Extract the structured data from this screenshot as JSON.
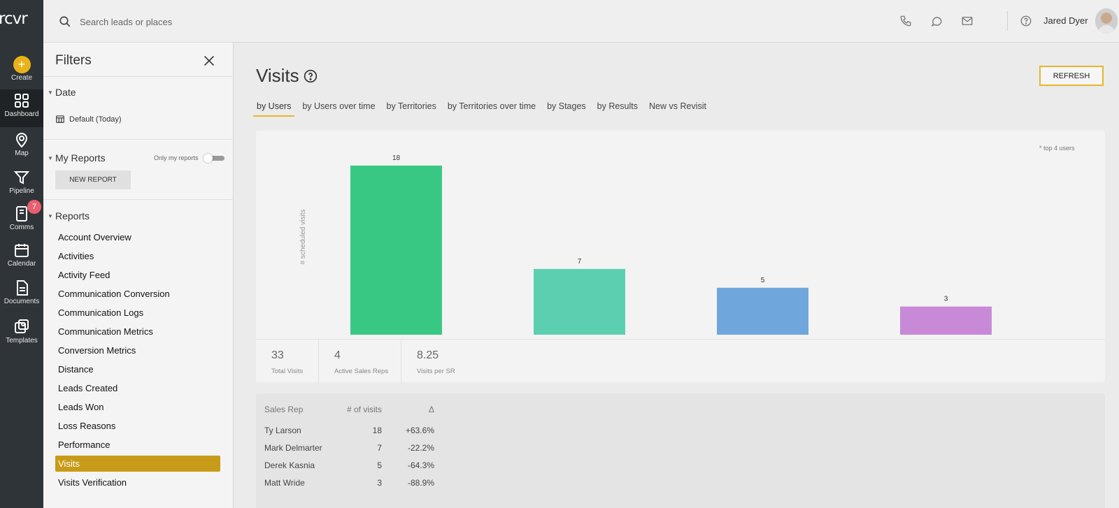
{
  "app": {
    "logo": "rcvr"
  },
  "rail": {
    "items": [
      {
        "label": "Create",
        "icon": "plus-icon"
      },
      {
        "label": "Dashboard",
        "icon": "dashboard-icon"
      },
      {
        "label": "Map",
        "icon": "map-pin-icon"
      },
      {
        "label": "Pipeline",
        "icon": "funnel-icon"
      },
      {
        "label": "Comms",
        "icon": "comms-icon",
        "badge": "7"
      },
      {
        "label": "Calendar",
        "icon": "calendar-icon"
      },
      {
        "label": "Documents",
        "icon": "document-icon"
      },
      {
        "label": "Templates",
        "icon": "templates-icon"
      }
    ]
  },
  "topbar": {
    "search_placeholder": "Search leads or places",
    "user_name": "Jared Dyer"
  },
  "filters": {
    "title": "Filters",
    "date_section": "Date",
    "date_value": "Default (Today)",
    "my_reports_section": "My Reports",
    "only_my_reports_label": "Only my reports",
    "new_report_label": "NEW REPORT",
    "reports_section": "Reports",
    "reports": [
      "Account Overview",
      "Activities",
      "Activity Feed",
      "Communication Conversion",
      "Communication Logs",
      "Communication Metrics",
      "Conversion Metrics",
      "Distance",
      "Leads Created",
      "Leads Won",
      "Loss Reasons",
      "Performance",
      "Visits",
      "Visits Verification"
    ],
    "active_report": "Visits"
  },
  "main": {
    "title": "Visits",
    "refresh_label": "REFRESH",
    "tabs": [
      "by Users",
      "by Users over time",
      "by Territories",
      "by Territories over time",
      "by Stages",
      "by Results",
      "New vs Revisit"
    ],
    "active_tab": "by Users",
    "top_note": "* top 4 users",
    "stats": [
      {
        "value": "33",
        "label": "Total Visits"
      },
      {
        "value": "4",
        "label": "Active Sales Reps"
      },
      {
        "value": "8.25",
        "label": "Visits per SR"
      }
    ],
    "table": {
      "headers": [
        "Sales Rep",
        "# of visits",
        "Δ"
      ],
      "rows": [
        {
          "rep": "Ty Larson",
          "visits": "18",
          "delta": "+63.6%",
          "trend": "up"
        },
        {
          "rep": "Mark Delmarter",
          "visits": "7",
          "delta": "-22.2%",
          "trend": "down"
        },
        {
          "rep": "Derek Kasnia",
          "visits": "5",
          "delta": "-64.3%",
          "trend": "down"
        },
        {
          "rep": "Matt Wride",
          "visits": "3",
          "delta": "-88.9%",
          "trend": "down"
        }
      ]
    }
  },
  "colors": {
    "accent": "#e6b62a",
    "active_report_bg": "#c79b18",
    "positive": "#6aa84f",
    "negative": "#b03a3a"
  },
  "chart_data": {
    "type": "bar",
    "categories": [
      "",
      "",
      "",
      ""
    ],
    "values": [
      18,
      7,
      5,
      3
    ],
    "colors": [
      "#38c883",
      "#5ccfb0",
      "#6fa6dc",
      "#c88ad6"
    ],
    "ylabel": "# scheduled visits",
    "ylim": [
      0,
      18
    ],
    "grid": false
  }
}
